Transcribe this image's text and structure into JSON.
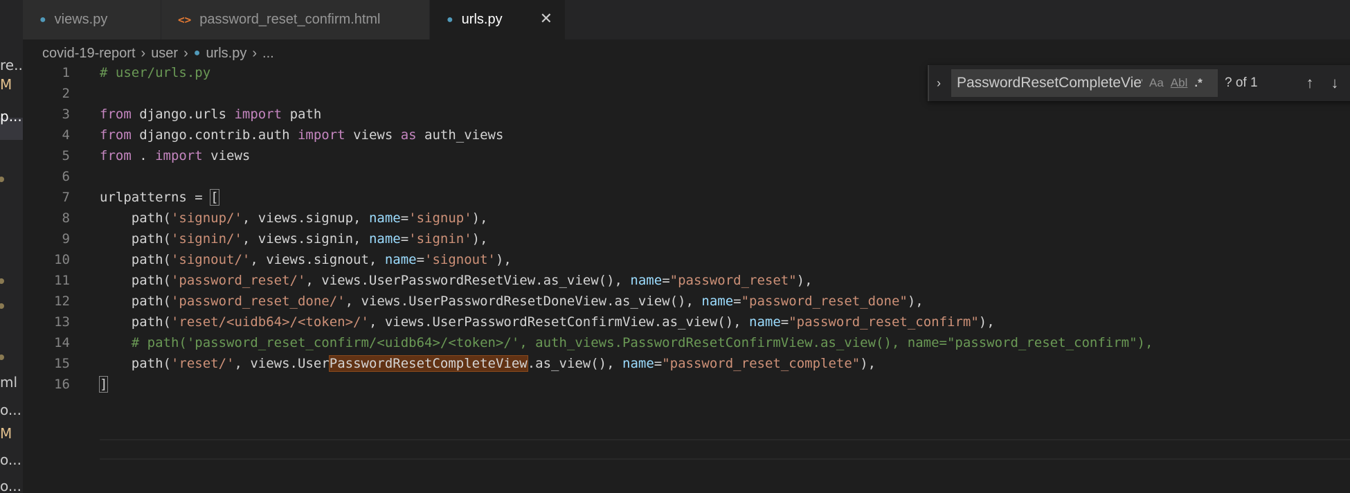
{
  "explorer": {
    "items": [
      {
        "text": "re..."
      },
      {
        "text": "M"
      },
      {
        "text": "p..."
      },
      {
        "text": "ml"
      },
      {
        "text": "o..."
      },
      {
        "text": "M"
      },
      {
        "text": "o..."
      },
      {
        "text": "o..."
      }
    ],
    "accent_color": "#e2c08d"
  },
  "tabs": [
    {
      "label": "views.py",
      "icon": "python-icon",
      "active": false
    },
    {
      "label": "password_reset_confirm.html",
      "icon": "html-icon",
      "active": false
    },
    {
      "label": "urls.py",
      "icon": "python-icon",
      "active": true
    }
  ],
  "breadcrumb": {
    "items": [
      "covid-19-report",
      "user",
      "urls.py",
      "..."
    ]
  },
  "find": {
    "query": "PasswordResetCompleteView",
    "match_case": "Aa",
    "whole_word": "Abl",
    "regex": ".*",
    "count": "? of 1"
  },
  "code": {
    "line_numbers": [
      "1",
      "2",
      "3",
      "4",
      "5",
      "6",
      "7",
      "8",
      "9",
      "10",
      "11",
      "12",
      "13",
      "14",
      "15",
      "16"
    ]
  },
  "colors": {
    "background": "#1e1e1e",
    "keyword": "#c586c0",
    "string": "#ce9178",
    "comment": "#6a9955",
    "parameter": "#9cdcfe",
    "match_highlight": "#613214"
  }
}
